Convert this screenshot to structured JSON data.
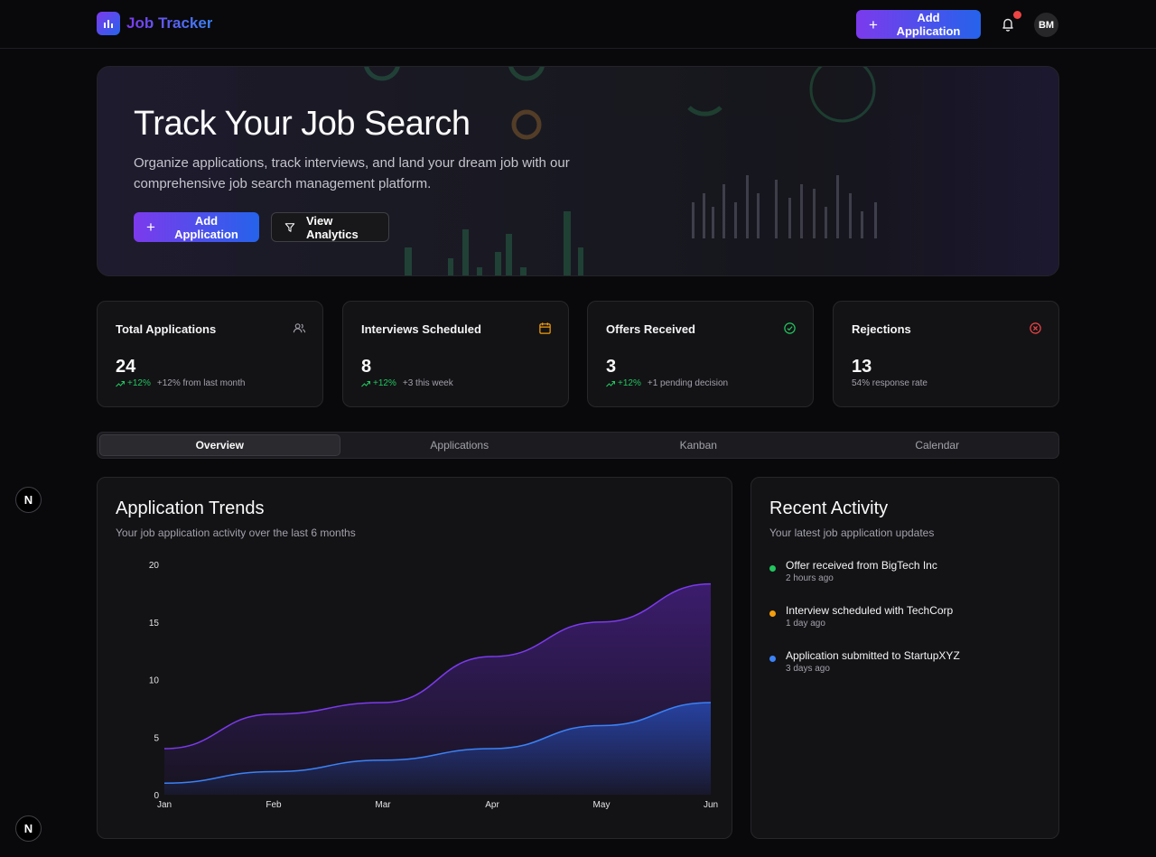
{
  "header": {
    "app_name": "Job Tracker",
    "add_button": "Add Application",
    "avatar_initials": "BM"
  },
  "hero": {
    "title": "Track Your Job Search",
    "subtitle": "Organize applications, track interviews, and land your dream job with our comprehensive job search management platform.",
    "add_button": "Add Application",
    "analytics_button": "View Analytics"
  },
  "stats": [
    {
      "title": "Total Applications",
      "value": "24",
      "trend": "+12%",
      "note": "+12% from last month",
      "icon": "users-icon",
      "color": "#a1a1aa"
    },
    {
      "title": "Interviews Scheduled",
      "value": "8",
      "trend": "+12%",
      "note": "+3 this week",
      "icon": "calendar-icon",
      "color": "#f59e0b"
    },
    {
      "title": "Offers Received",
      "value": "3",
      "trend": "+12%",
      "note": "+1 pending decision",
      "icon": "check-circle-icon",
      "color": "#22c55e"
    },
    {
      "title": "Rejections",
      "value": "13",
      "trend": "",
      "note": "54% response rate",
      "icon": "x-circle-icon",
      "color": "#ef4444"
    }
  ],
  "tabs": [
    {
      "label": "Overview",
      "active": true
    },
    {
      "label": "Applications",
      "active": false
    },
    {
      "label": "Kanban",
      "active": false
    },
    {
      "label": "Calendar",
      "active": false
    }
  ],
  "trends": {
    "title": "Application Trends",
    "subtitle": "Your job application activity over the last 6 months"
  },
  "chart_data": {
    "type": "area",
    "categories": [
      "Jan",
      "Feb",
      "Mar",
      "Apr",
      "May",
      "Jun"
    ],
    "series": [
      {
        "values": [
          4,
          7,
          8,
          12,
          15,
          18.3
        ],
        "color": "#7c3aed"
      },
      {
        "values": [
          1,
          2,
          3,
          4,
          6,
          8
        ],
        "color": "#3b82f6"
      }
    ],
    "yticks": [
      0,
      5,
      10,
      15,
      20
    ],
    "ylim": [
      0,
      20
    ],
    "grid": false
  },
  "activity": {
    "title": "Recent Activity",
    "subtitle": "Your latest job application updates",
    "items": [
      {
        "text": "Offer received from BigTech Inc",
        "time": "2 hours ago",
        "color": "#22c55e"
      },
      {
        "text": "Interview scheduled with TechCorp",
        "time": "1 day ago",
        "color": "#f59e0b"
      },
      {
        "text": "Application submitted to StartupXYZ",
        "time": "3 days ago",
        "color": "#3b82f6"
      }
    ]
  },
  "dev_badge": "N"
}
